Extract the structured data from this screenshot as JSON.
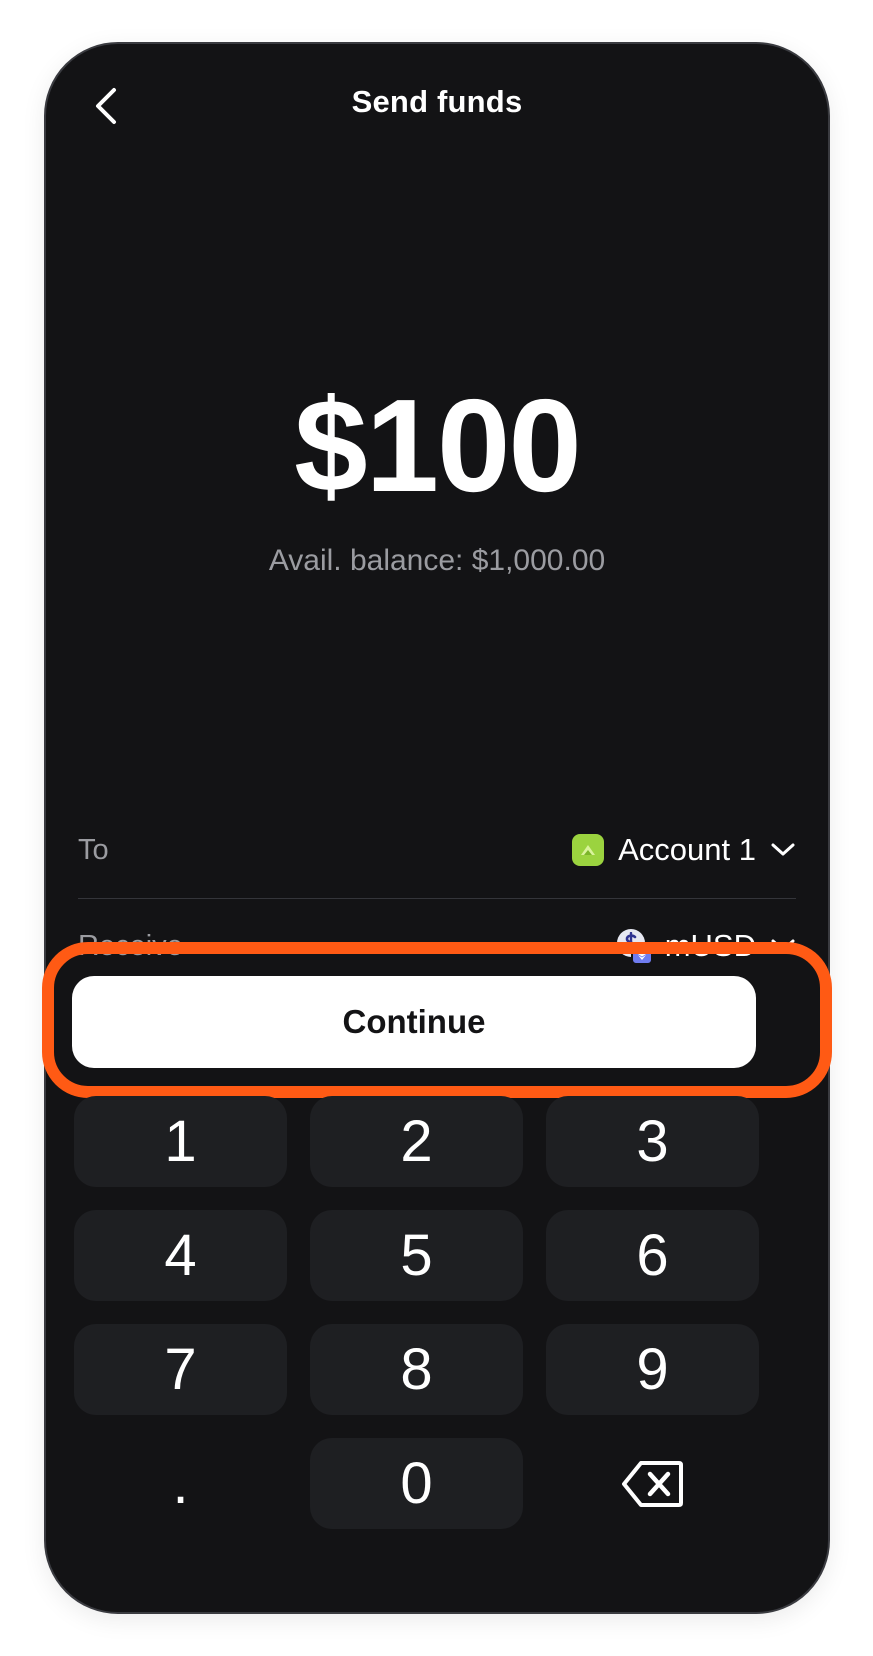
{
  "header": {
    "title": "Send funds",
    "back_icon": "chevron-left-icon"
  },
  "amount": {
    "value": "$100",
    "balance": "Avail. balance: $1,000.00"
  },
  "to_row": {
    "label": "To",
    "value": "Account 1",
    "icon": "account-avatar-icon",
    "chevron": "chevron-down-icon"
  },
  "receive_row": {
    "label": "Receive",
    "value": "mUSD",
    "icon": "musd-token-icon",
    "chevron": "chevron-down-icon"
  },
  "continue": {
    "label": "Continue"
  },
  "keypad": {
    "keys": [
      "1",
      "2",
      "3",
      "4",
      "5",
      "6",
      "7",
      "8",
      "9",
      ".",
      "0"
    ],
    "backspace_icon": "backspace-icon"
  },
  "colors": {
    "background": "#131315",
    "highlight": "#ff5a14",
    "key_background": "#1e1f22",
    "account_icon": "#9bd33f"
  }
}
